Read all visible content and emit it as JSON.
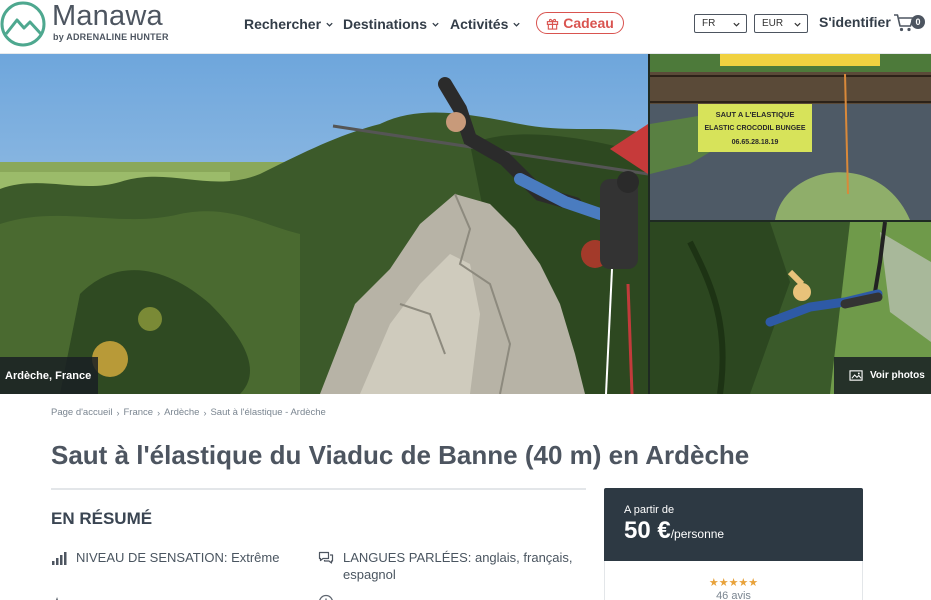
{
  "brand": {
    "name": "Manawa",
    "tagline": "by ADRENALINE HUNTER",
    "accent_color": "#4ea88f"
  },
  "nav": {
    "items": [
      {
        "label": "Rechercher"
      },
      {
        "label": "Destinations"
      },
      {
        "label": "Activités"
      }
    ],
    "gift_label": "Cadeau",
    "language": "FR",
    "currency": "EUR",
    "signin_label": "S'identifier",
    "cart_count": "0"
  },
  "gallery": {
    "location": "Ardèche, France",
    "view_photos_label": "Voir photos",
    "sign_lines": [
      "SAUT A L'ELASTIQUE",
      "ELASTIC CROCODIL BUNGEE",
      "06.65.28.18.19"
    ]
  },
  "breadcrumb": [
    "Page d'accueil",
    "France",
    "Ardèche",
    "Saut à l'élastique - Ardèche"
  ],
  "page_title": "Saut à l'élastique du Viaduc de Banne (40 m) en Ardèche",
  "summary": {
    "heading": "EN RÉSUMÉ",
    "features": [
      {
        "icon": "signal-bars-icon",
        "label": "NIVEAU DE SENSATION: Extrême"
      },
      {
        "icon": "speech-bubbles-icon",
        "label": "LANGUES PARLÉES: anglais, français, espagnol"
      }
    ]
  },
  "pricing": {
    "from_label": "A partir de",
    "amount": "50 €",
    "unit": "/personne",
    "stars": "★★★★★",
    "reviews": "46 avis"
  },
  "colors": {
    "price_card_bg": "#2d3943",
    "gift_red": "#d9534f",
    "star": "#e8a23a",
    "text_dark": "#4d5560"
  }
}
